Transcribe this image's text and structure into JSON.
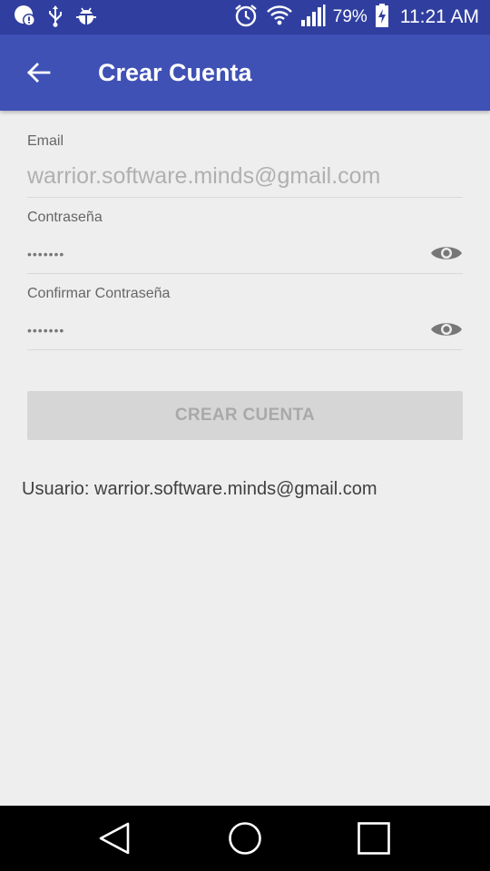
{
  "status_bar": {
    "battery_percent": "79%",
    "time": "11:21 AM",
    "left_icons": [
      "chat-alert-icon",
      "usb-icon",
      "android-debug-icon"
    ],
    "right_icons": [
      "alarm-icon",
      "wifi-icon",
      "signal-icon",
      "battery-charging-icon"
    ]
  },
  "app_bar": {
    "title": "Crear Cuenta",
    "back_icon": "arrow-back-icon"
  },
  "form": {
    "email": {
      "label": "Email",
      "value": "warrior.software.minds@gmail.com"
    },
    "password": {
      "label": "Contraseña",
      "value": "•••••••",
      "toggle_icon": "eye-icon"
    },
    "confirm_password": {
      "label": "Confirmar Contraseña",
      "value": "•••••••",
      "toggle_icon": "eye-icon"
    },
    "submit_label": "CREAR CUENTA"
  },
  "user_info": "Usuario: warrior.software.minds@gmail.com",
  "nav_bar": {
    "buttons": [
      "back-triangle-icon",
      "home-circle-icon",
      "recents-square-icon"
    ]
  },
  "colors": {
    "status_bar": "#303f9f",
    "app_bar": "#3f51b5",
    "background": "#eeeeee",
    "button_disabled": "#d6d6d6"
  }
}
